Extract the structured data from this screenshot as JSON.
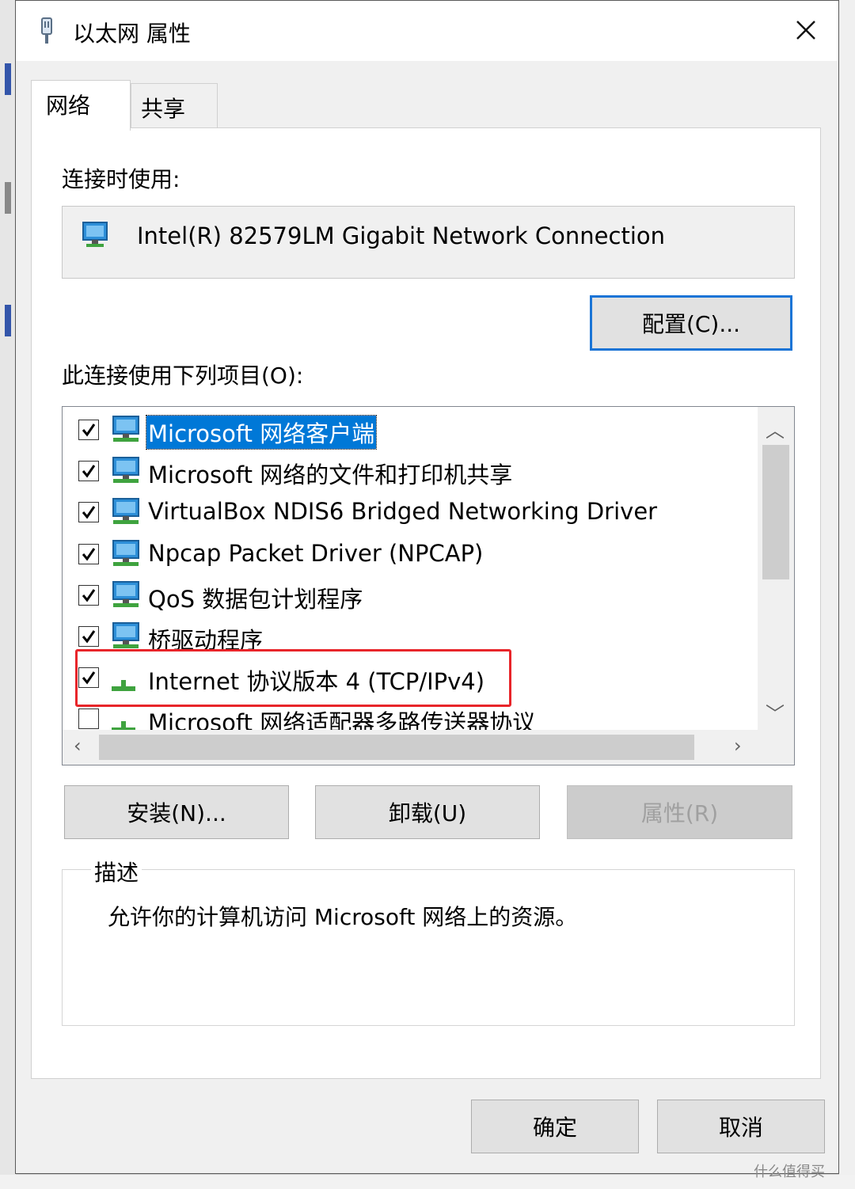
{
  "window": {
    "title": "以太网 属性",
    "close_icon": "close-icon"
  },
  "tabs": [
    {
      "label": "网络",
      "active": true
    },
    {
      "label": "共享",
      "active": false
    }
  ],
  "connect_using": {
    "label": "连接时使用:",
    "adapter": "Intel(R) 82579LM Gigabit Network Connection",
    "configure_button": "配置(C)..."
  },
  "items_section": {
    "label": "此连接使用下列项目(O):",
    "items": [
      {
        "label": "Microsoft 网络客户端",
        "checked": true,
        "icon": "network-client-icon",
        "selected": true
      },
      {
        "label": "Microsoft 网络的文件和打印机共享",
        "checked": true,
        "icon": "network-service-icon",
        "selected": false
      },
      {
        "label": "VirtualBox NDIS6 Bridged Networking Driver",
        "checked": true,
        "icon": "network-service-icon",
        "selected": false
      },
      {
        "label": "Npcap Packet Driver (NPCAP)",
        "checked": true,
        "icon": "network-service-icon",
        "selected": false
      },
      {
        "label": "QoS 数据包计划程序",
        "checked": true,
        "icon": "network-service-icon",
        "selected": false
      },
      {
        "label": "桥驱动程序",
        "checked": true,
        "icon": "network-service-icon",
        "selected": false
      },
      {
        "label": "Internet 协议版本 4 (TCP/IPv4)",
        "checked": true,
        "icon": "protocol-icon",
        "selected": false
      },
      {
        "label": "Microsoft 网络适配器多路传送器协议",
        "checked": false,
        "icon": "protocol-icon",
        "selected": false
      }
    ]
  },
  "buttons": {
    "install": "安装(N)...",
    "uninstall": "卸载(U)",
    "properties": "属性(R)"
  },
  "description": {
    "legend": "描述",
    "text": "允许你的计算机访问 Microsoft 网络上的资源。"
  },
  "footer": {
    "ok": "确定",
    "cancel": "取消"
  },
  "watermark": "什么值得买",
  "colors": {
    "selection": "#0078d7",
    "highlight_box": "#e8252a",
    "focus_border": "#1a74d6"
  }
}
